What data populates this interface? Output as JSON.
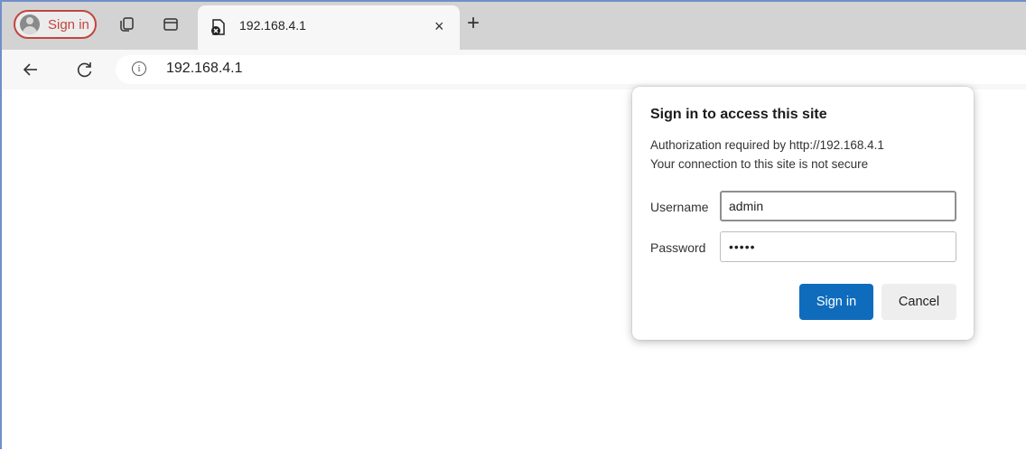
{
  "browser": {
    "profile_label": "Sign in",
    "tab": {
      "title": "192.168.4.1",
      "close_glyph": "×"
    },
    "new_tab_glyph": "+",
    "address_bar": {
      "url": "192.168.4.1",
      "info_glyph": "i"
    }
  },
  "dialog": {
    "title": "Sign in to access this site",
    "line1": "Authorization required by http://192.168.4.1",
    "line2": "Your connection to this site is not secure",
    "username_label": "Username",
    "username_value": "admin",
    "password_label": "Password",
    "password_masked": "•••••",
    "signin_label": "Sign in",
    "cancel_label": "Cancel"
  },
  "colors": {
    "accent": "#0f6cbd",
    "profile_border": "#c2453f",
    "tabstrip": "#d3d3d3"
  },
  "icons": [
    "person-avatar-icon",
    "workspaces-icon",
    "tab-actions-icon",
    "site-warning-icon",
    "close-icon",
    "plus-icon",
    "back-arrow-icon",
    "refresh-icon",
    "info-icon"
  ]
}
